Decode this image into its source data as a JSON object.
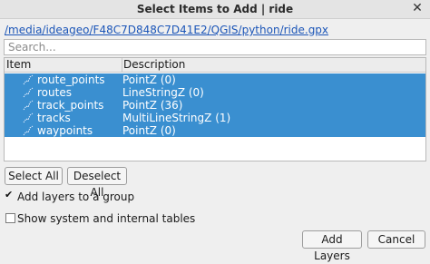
{
  "window": {
    "title": "Select Items to Add | ride"
  },
  "source_path": "/media/ideageo/F48C7D848C7D41E2/QGIS/python/ride.gpx",
  "search": {
    "placeholder": "Search..."
  },
  "table": {
    "headers": {
      "item": "Item",
      "description": "Description"
    },
    "rows": [
      {
        "name": "route_points",
        "description": "PointZ (0)"
      },
      {
        "name": "routes",
        "description": "LineStringZ (0)"
      },
      {
        "name": "track_points",
        "description": "PointZ (36)"
      },
      {
        "name": "tracks",
        "description": "MultiLineStringZ (1)"
      },
      {
        "name": "waypoints",
        "description": "PointZ (0)"
      }
    ]
  },
  "buttons": {
    "select_all": "Select All",
    "deselect_all": "Deselect All",
    "add_layers": "Add Layers",
    "cancel": "Cancel"
  },
  "options": {
    "add_to_group": {
      "label": "Add layers to a group",
      "checked": true
    },
    "show_system_tables": {
      "label": "Show system and internal tables",
      "checked": false
    }
  },
  "icons": {
    "layer_row": "vector-layer-icon",
    "close": "close-icon"
  },
  "colors": {
    "selection": "#3a8fd0",
    "link": "#1c56b8"
  }
}
